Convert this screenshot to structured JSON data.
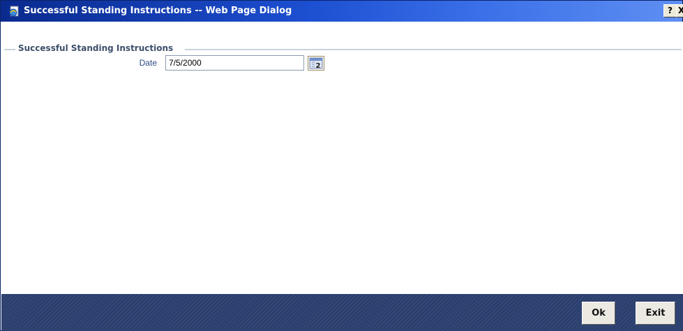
{
  "window": {
    "title": "Successful Standing Instructions -- Web Page Dialog",
    "help_label": "?",
    "close_label": "X"
  },
  "section": {
    "title": "Successful Standing Instructions"
  },
  "form": {
    "date_label": "Date",
    "date_value": "7/5/2000",
    "calendar_icon_text": "2"
  },
  "footer": {
    "ok_label": "Ok",
    "exit_label": "Exit"
  },
  "colors": {
    "titlebar": "#1c4fd1",
    "footer": "#2b3f6e",
    "section_title": "#3d4f6b",
    "label": "#2e4a80"
  }
}
